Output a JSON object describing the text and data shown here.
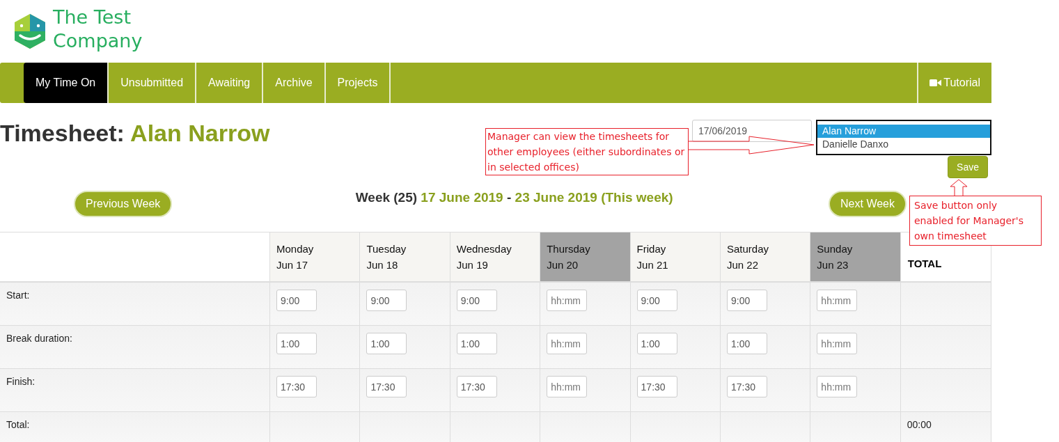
{
  "logo": {
    "line_1": "The Test",
    "line_2": "Company"
  },
  "nav": {
    "tabs": [
      {
        "label": "My Time On",
        "selected": true
      },
      {
        "label": "Unsubmitted",
        "selected": false
      },
      {
        "label": "Awaiting",
        "selected": false
      },
      {
        "label": "Archive",
        "selected": false
      },
      {
        "label": "Projects",
        "selected": false
      }
    ],
    "tutorial": "Tutorial"
  },
  "title": {
    "label": "Timesheet:",
    "name": "Alan Narrow"
  },
  "date_field": {
    "value": "17/06/2019"
  },
  "employee_list": [
    {
      "name": "Alan Narrow",
      "selected": true
    },
    {
      "name": "Danielle Danxo",
      "selected": false
    }
  ],
  "save_button": "Save",
  "week": {
    "prefix": "Week (25)",
    "start": "17 June 2019",
    "separator": "-",
    "end": "23 June 2019 (This week)"
  },
  "previous_button": "Previous Week",
  "next_button": "Next Week",
  "annotations": [
    {
      "text": "Manager can view the timesheets for other employees (either subordinates or in selected offices)"
    },
    {
      "text": "Save button only enabled for Manager's own timesheet"
    }
  ],
  "table": {
    "total_heading": "TOTAL",
    "days": [
      {
        "name": "Monday",
        "date": "Jun 17",
        "highlighted": false
      },
      {
        "name": "Tuesday",
        "date": "Jun 18",
        "highlighted": false
      },
      {
        "name": "Wednesday",
        "date": "Jun 19",
        "highlighted": false
      },
      {
        "name": "Thursday",
        "date": "Jun 20",
        "highlighted": true
      },
      {
        "name": "Friday",
        "date": "Jun 21",
        "highlighted": false
      },
      {
        "name": "Saturday",
        "date": "Jun 22",
        "highlighted": false
      },
      {
        "name": "Sunday",
        "date": "Jun 23",
        "highlighted": true
      }
    ],
    "rows": [
      {
        "label": "Start:",
        "cells": [
          {
            "value": "9:00"
          },
          {
            "value": "9:00"
          },
          {
            "value": "9:00"
          },
          {
            "placeholder": "hh:mm"
          },
          {
            "value": "9:00"
          },
          {
            "value": "9:00"
          },
          {
            "placeholder": "hh:mm"
          }
        ]
      },
      {
        "label": "Break duration:",
        "cells": [
          {
            "value": "1:00"
          },
          {
            "value": "1:00"
          },
          {
            "value": "1:00"
          },
          {
            "placeholder": "hh:mm"
          },
          {
            "value": "1:00"
          },
          {
            "value": "1:00"
          },
          {
            "placeholder": "hh:mm"
          }
        ]
      },
      {
        "label": "Finish:",
        "cells": [
          {
            "value": "17:30"
          },
          {
            "value": "17:30"
          },
          {
            "value": "17:30"
          },
          {
            "placeholder": "hh:mm"
          },
          {
            "value": "17:30"
          },
          {
            "value": "17:30"
          },
          {
            "placeholder": "hh:mm"
          }
        ]
      }
    ],
    "total_row": {
      "label": "Total:",
      "total": "00:00"
    }
  }
}
